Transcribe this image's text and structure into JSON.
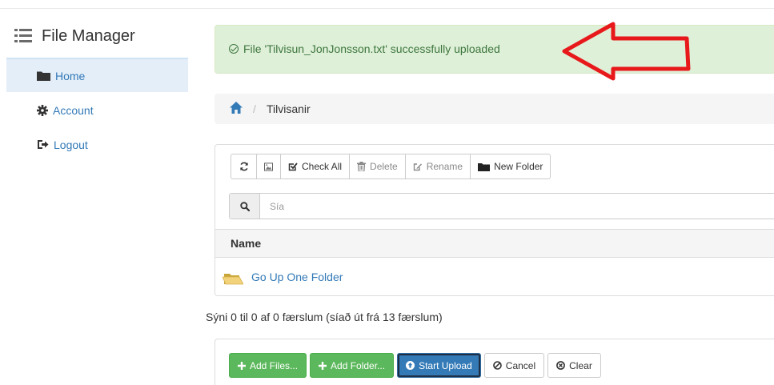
{
  "brand": {
    "title": "File Manager"
  },
  "sidebar": {
    "items": [
      {
        "label": "Home",
        "icon": "folder-icon",
        "active": true
      },
      {
        "label": "Account",
        "icon": "gear-icon",
        "active": false
      },
      {
        "label": "Logout",
        "icon": "logout-icon",
        "active": false
      }
    ]
  },
  "alert": {
    "message": "File 'Tilvisun_JonJonsson.txt' successfully uploaded",
    "color": "#3c763d",
    "background": "#dff0d8"
  },
  "annotation": {
    "arrow_color": "#e8191b",
    "arrow_direction": "left"
  },
  "breadcrumb": {
    "current": "Tilvisanir",
    "separator": "/"
  },
  "toolbar": {
    "check_all": "Check All",
    "delete": "Delete",
    "rename": "Rename",
    "new_folder": "New Folder"
  },
  "search": {
    "placeholder": "Sía"
  },
  "table": {
    "headers": [
      "Name"
    ],
    "rows": [
      {
        "name": "Go Up One Folder",
        "icon": "folder-up-icon"
      }
    ]
  },
  "summary": "Sýni 0 til 0 af 0 færslum (síað út frá 13 færslum)",
  "upload": {
    "add_files": "Add Files...",
    "add_folder": "Add Folder...",
    "start_upload": "Start Upload",
    "cancel": "Cancel",
    "clear": "Clear"
  },
  "colors": {
    "link": "#337ab7",
    "success": "#5cb85c",
    "primary": "#337ab7"
  }
}
